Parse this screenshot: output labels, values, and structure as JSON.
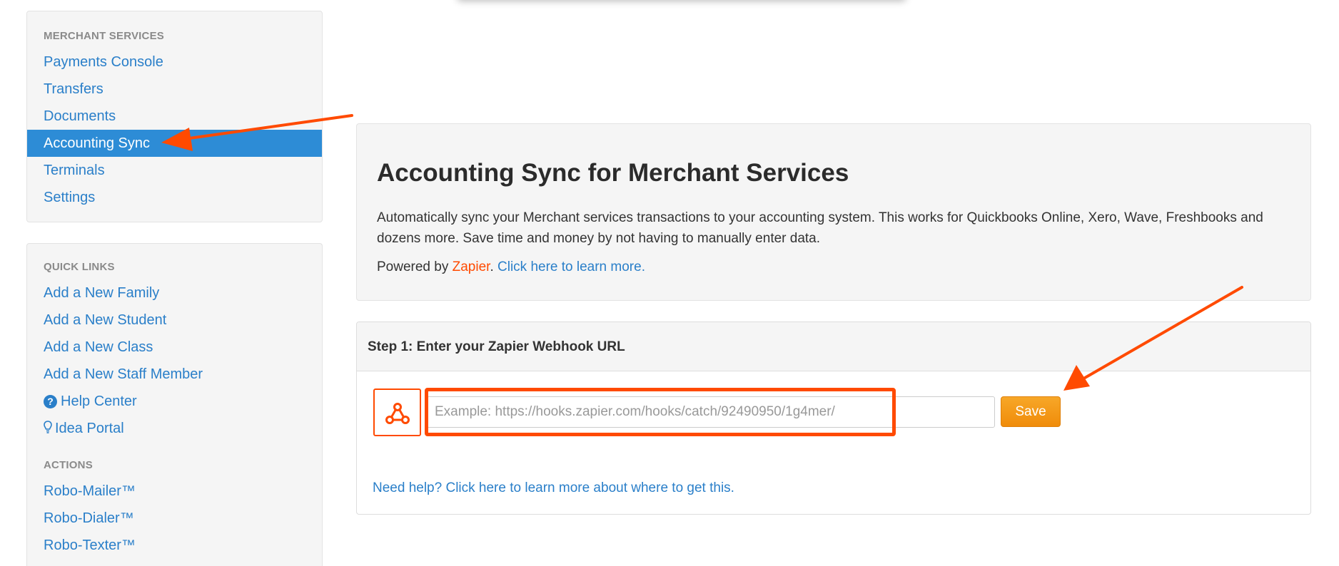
{
  "sidebar": {
    "merchant": {
      "heading": "MERCHANT SERVICES",
      "items": [
        {
          "label": "Payments Console"
        },
        {
          "label": "Transfers"
        },
        {
          "label": "Documents"
        },
        {
          "label": "Accounting Sync",
          "active": true
        },
        {
          "label": "Terminals"
        },
        {
          "label": "Settings"
        }
      ]
    },
    "quick_links": {
      "heading": "QUICK LINKS",
      "items": [
        {
          "label": "Add a New Family"
        },
        {
          "label": "Add a New Student"
        },
        {
          "label": "Add a New Class"
        },
        {
          "label": "Add a New Staff Member"
        },
        {
          "label": "Help Center",
          "icon": "question-circle-icon"
        },
        {
          "label": "Idea Portal",
          "icon": "lightbulb-icon"
        }
      ]
    },
    "actions": {
      "heading": "ACTIONS",
      "items": [
        {
          "label": "Robo-Mailer™"
        },
        {
          "label": "Robo-Dialer™"
        },
        {
          "label": "Robo-Texter™"
        }
      ]
    }
  },
  "hero": {
    "title": "Accounting Sync for Merchant Services",
    "description": "Automatically sync your Merchant services transactions to your accounting system. This works for Quickbooks Online, Xero, Wave, Freshbooks and dozens more. Save time and money by not having to manually enter data.",
    "powered_prefix": "Powered by ",
    "zapier_label": "Zapier",
    "period": ". ",
    "learn_more_label": "Click here to learn more."
  },
  "step1": {
    "title": "Step 1: Enter your Zapier Webhook URL",
    "input_placeholder": "Example: https://hooks.zapier.com/hooks/catch/92490950/1g4mer/",
    "input_value": "",
    "save_label": "Save",
    "help_label": "Need help? Click here to learn more about where to get this."
  },
  "colors": {
    "accent_blue": "#2d8cd6",
    "link_blue": "#2a7fc9",
    "zapier_orange": "#ff4a00",
    "save_orange": "#f39a1a",
    "annotation_red": "#ff4a00"
  }
}
